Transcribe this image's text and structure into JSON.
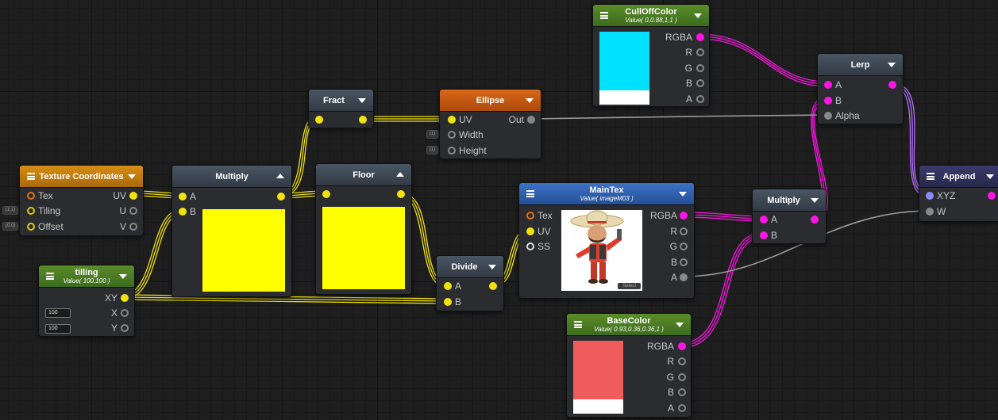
{
  "nodes": {
    "culloff": {
      "title": "CullOffColor",
      "subtitle": "Value( 0,0.88,1,1 )",
      "outputs": [
        "RGBA",
        "R",
        "G",
        "B",
        "A"
      ],
      "swatch_color": "#00e0ff"
    },
    "lerp": {
      "title": "Lerp",
      "inputs": [
        "A",
        "B",
        "Alpha"
      ]
    },
    "fract": {
      "title": "Fract"
    },
    "ellipse": {
      "title": "Ellipse",
      "inputs": [
        "UV",
        "Width",
        "Height"
      ],
      "output": "Out",
      "chips": [
        "(1)",
        "(1)"
      ]
    },
    "texcoord": {
      "title": "Texture Coordinates",
      "inputs": [
        "Tex",
        "Tiling",
        "Offset"
      ],
      "outputs": [
        "UV",
        "U",
        "V"
      ],
      "chips": [
        "(1,1)",
        "(0,0)"
      ]
    },
    "multiply1": {
      "title": "Multiply",
      "inputs": [
        "A",
        "B"
      ],
      "swatch_color": "#ffff00"
    },
    "floor": {
      "title": "Floor",
      "swatch_color": "#ffff00"
    },
    "maintex": {
      "title": "MainTex",
      "subtitle": "Value( imageM03 )",
      "inputs": [
        "Tex",
        "UV",
        "SS"
      ],
      "outputs": [
        "RGBA",
        "R",
        "G",
        "B",
        "A"
      ],
      "select_label": "Select"
    },
    "multiply2": {
      "title": "Multiply",
      "inputs": [
        "A",
        "B"
      ]
    },
    "append": {
      "title": "Append",
      "inputs": [
        "XYZ",
        "W"
      ]
    },
    "tilling": {
      "title": "tilling",
      "subtitle": "Value( 100,100 )",
      "outputs": [
        "XY",
        "X",
        "Y"
      ],
      "fields": [
        "100",
        "100"
      ]
    },
    "divide": {
      "title": "Divide",
      "inputs": [
        "A",
        "B"
      ]
    },
    "basecolor": {
      "title": "BaseColor",
      "subtitle": "Value( 0.93,0.36,0.36,1 )",
      "outputs": [
        "RGBA",
        "R",
        "G",
        "B",
        "A"
      ],
      "swatch_color": "#ee5c5c"
    }
  },
  "colors": {
    "vec2_wire": "#f2e20d",
    "color_wire": "#ff14e6",
    "vec4_wire": "#b870ff",
    "float_wire": "#9a9a9a"
  }
}
